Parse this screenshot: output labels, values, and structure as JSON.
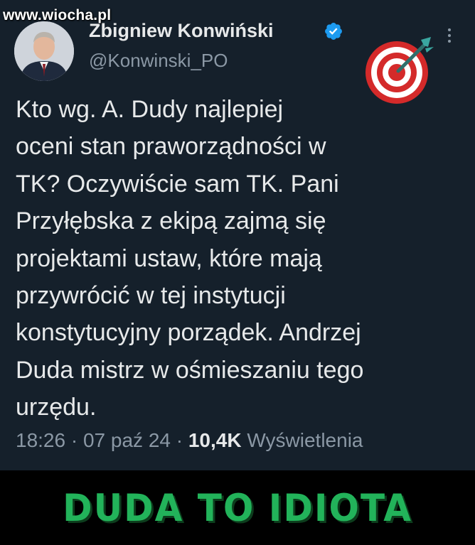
{
  "watermark": "www.wiocha.pl",
  "author": {
    "name": "Zbigniew Konwiński",
    "handle": "@Konwinski_PO",
    "verified_icon": "verified-badge-icon",
    "badge_color": "#1d9bf0"
  },
  "post": {
    "lines": [
      "Kto wg. A. Dudy najlepiej",
      "oceni stan praworządności w",
      "TK? Oczywiście sam TK. Pani",
      "Przyłębska z ekipą zajmą się",
      "projektami ustaw, które mają",
      "przywrócić w tej instytucji",
      "konstytucyjny porządek. Andrzej",
      "Duda mistrz w ośmieszaniu tego",
      "urzędu."
    ]
  },
  "meta": {
    "time": "18:26",
    "separator": " · ",
    "date": "07 paź 24",
    "views_count": "10,4K",
    "views_label": "Wyświetlenia"
  },
  "sticker_icon": "target-bullseye-icon",
  "caption": "DUDA TO IDIOTA",
  "colors": {
    "tweet_background": "#15202b",
    "text": "#e7e9ea",
    "secondary_text": "#8b98a5",
    "caption_green": "#22b35a",
    "caption_background": "#000000"
  }
}
